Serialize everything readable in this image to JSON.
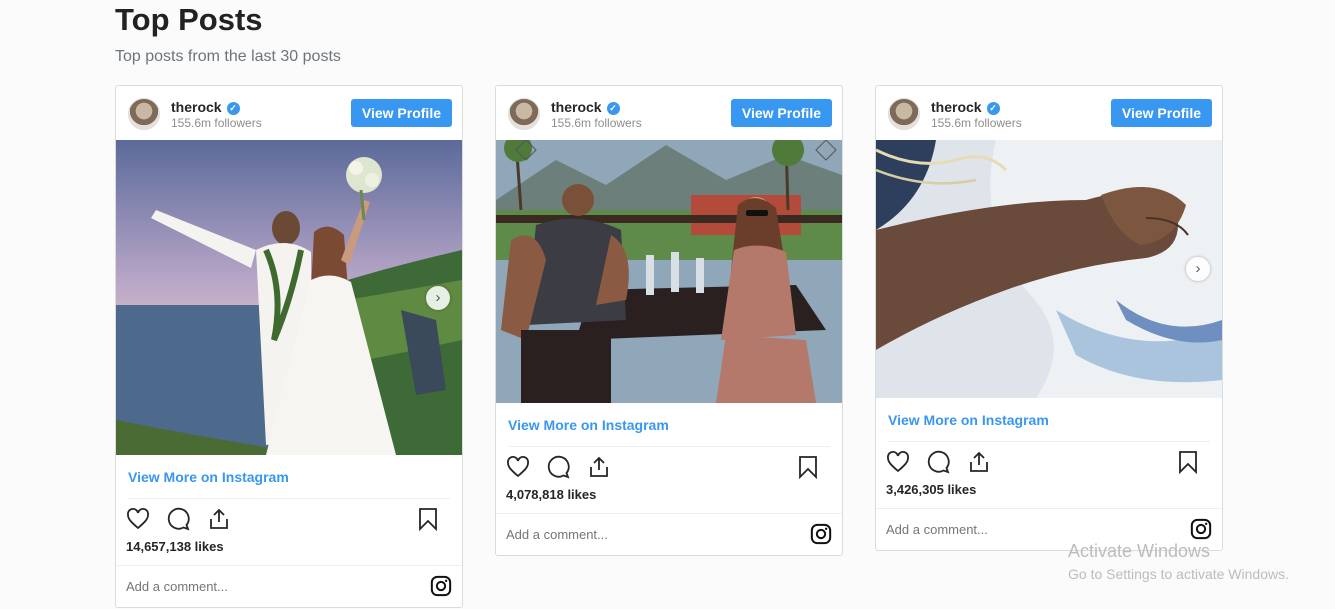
{
  "page": {
    "title": "Top Posts",
    "subtitle": "Top posts from the last 30 posts"
  },
  "posts": [
    {
      "username": "therock",
      "verified_mark": "✓",
      "followers": "155.6m followers",
      "view_profile": "View Profile",
      "view_more": "View More on Instagram",
      "likes": "14,657,138 likes",
      "comment_placeholder": "Add a comment...",
      "has_carousel": true
    },
    {
      "username": "therock",
      "verified_mark": "✓",
      "followers": "155.6m followers",
      "view_profile": "View Profile",
      "view_more": "View More on Instagram",
      "likes": "4,078,818 likes",
      "comment_placeholder": "Add a comment...",
      "has_carousel": false
    },
    {
      "username": "therock",
      "verified_mark": "✓",
      "followers": "155.6m followers",
      "view_profile": "View Profile",
      "view_more": "View More on Instagram",
      "likes": "3,426,305 likes",
      "comment_placeholder": "Add a comment...",
      "has_carousel": true
    }
  ],
  "icons": {
    "like": "heart-icon",
    "comment": "comment-bubble-icon",
    "share": "share-upload-icon",
    "save": "bookmark-icon",
    "brand": "instagram-icon"
  },
  "colors": {
    "accent": "#3897f0",
    "text": "#262626",
    "muted": "#8e8e8e"
  },
  "watermark": {
    "title": "Activate Windows",
    "subtitle": "Go to Settings to activate Windows."
  }
}
